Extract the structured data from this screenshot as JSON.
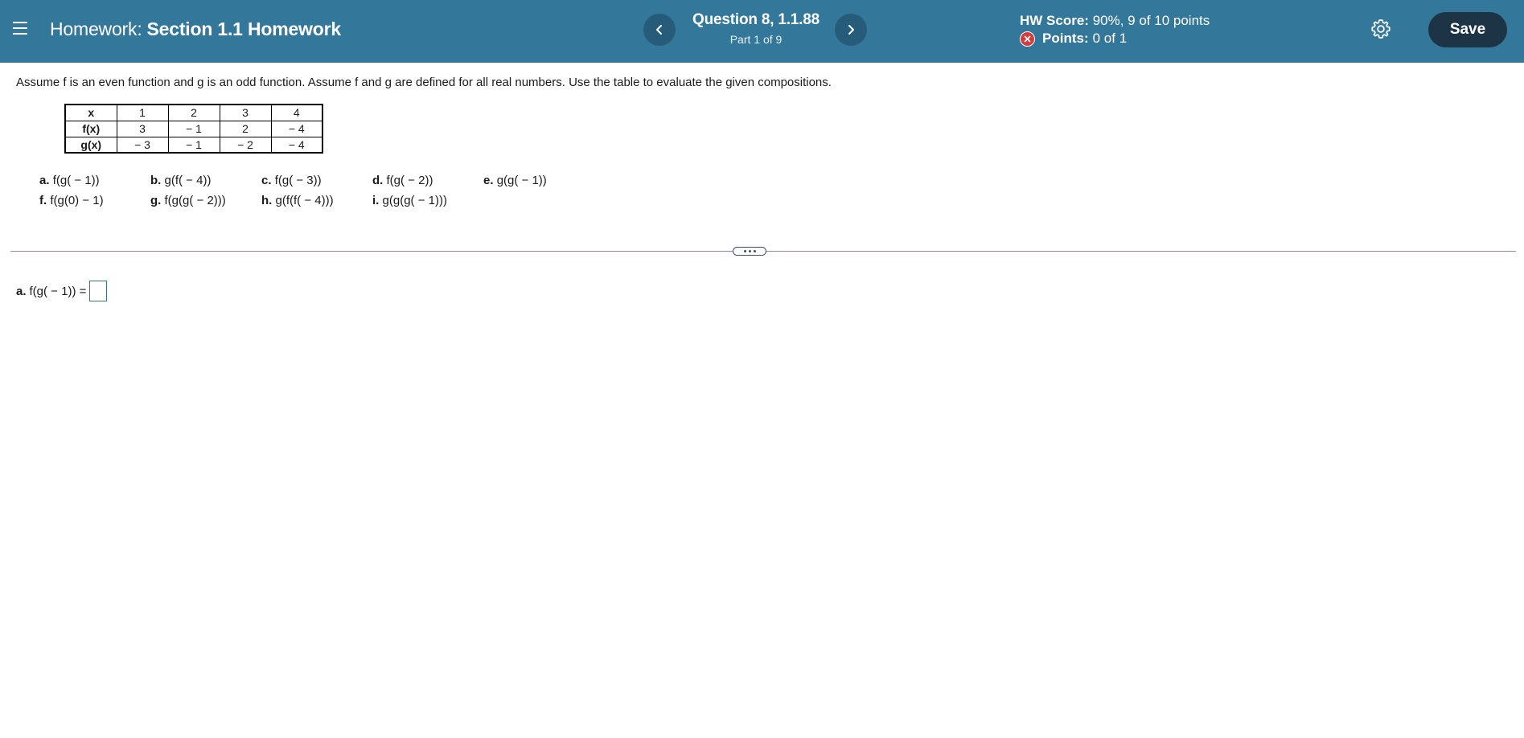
{
  "header": {
    "homework_label": "Homework:",
    "homework_name": "Section 1.1 Homework",
    "question_title": "Question 8, 1.1.88",
    "question_part": "Part 1 of 9",
    "score_label": "HW Score:",
    "score_value": "90%, 9 of 10 points",
    "points_label": "Points:",
    "points_value": "0 of 1",
    "save_label": "Save",
    "prev_glyph": "‹",
    "next_glyph": "›"
  },
  "colors": {
    "header_bg": "#33779b",
    "nav_button_bg": "#265c79",
    "save_button_bg": "#1d3346",
    "error_red": "#d33d3d"
  },
  "icons": [
    "menu-icon",
    "chevron-left-icon",
    "chevron-right-icon",
    "error-x-icon",
    "gear-icon"
  ],
  "problem": {
    "instructions": "Assume f is an even function and g is an odd function. Assume f and g are defined for all real numbers. Use the table to evaluate the given compositions.",
    "table": {
      "rows": [
        {
          "header": "x",
          "cells": [
            "1",
            "2",
            "3",
            "4"
          ]
        },
        {
          "header": "f(x)",
          "cells": [
            "3",
            "− 1",
            "2",
            "− 4"
          ]
        },
        {
          "header": "g(x)",
          "cells": [
            "− 3",
            "− 1",
            "− 2",
            "− 4"
          ]
        }
      ]
    },
    "parts_row1": [
      {
        "letter": "a.",
        "expr": "f(g( − 1))"
      },
      {
        "letter": "b.",
        "expr": "g(f( − 4))"
      },
      {
        "letter": "c.",
        "expr": "f(g( − 3))"
      },
      {
        "letter": "d.",
        "expr": "f(g( − 2))"
      },
      {
        "letter": "e.",
        "expr": "g(g( − 1))"
      }
    ],
    "parts_row2": [
      {
        "letter": "f.",
        "expr": "f(g(0) − 1)"
      },
      {
        "letter": "g.",
        "expr": "f(g(g( − 2)))"
      },
      {
        "letter": "h.",
        "expr": "g(f(f( − 4)))"
      },
      {
        "letter": "i.",
        "expr": "g(g(g( − 1)))"
      }
    ]
  },
  "answer": {
    "letter": "a.",
    "prompt": "f(g( − 1)) =",
    "value": ""
  }
}
